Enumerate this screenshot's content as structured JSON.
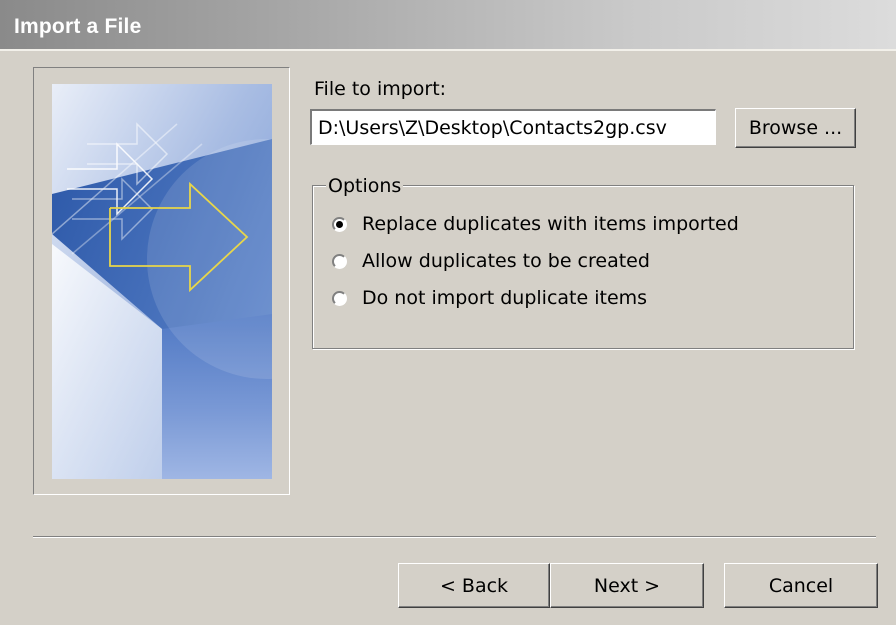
{
  "window": {
    "title": "Import a File"
  },
  "file_section": {
    "label": "File to import:",
    "value": "D:\\Users\\Z\\Desktop\\Contacts2gp.csv",
    "browse_label": "Browse ..."
  },
  "options": {
    "legend": "Options",
    "items": [
      {
        "label": "Replace duplicates with items imported",
        "selected": true
      },
      {
        "label": "Allow duplicates to be created",
        "selected": false
      },
      {
        "label": "Do not import duplicate items",
        "selected": false
      }
    ]
  },
  "footer": {
    "back_label": "< Back",
    "next_label": "Next >",
    "cancel_label": "Cancel"
  },
  "icons": {
    "wizard_art": "import-arrows-illustration"
  },
  "colors": {
    "dialog_background": "#d4d0c8",
    "art_blue": "#3f68b8",
    "arrow_outline": "#e8d64a"
  }
}
